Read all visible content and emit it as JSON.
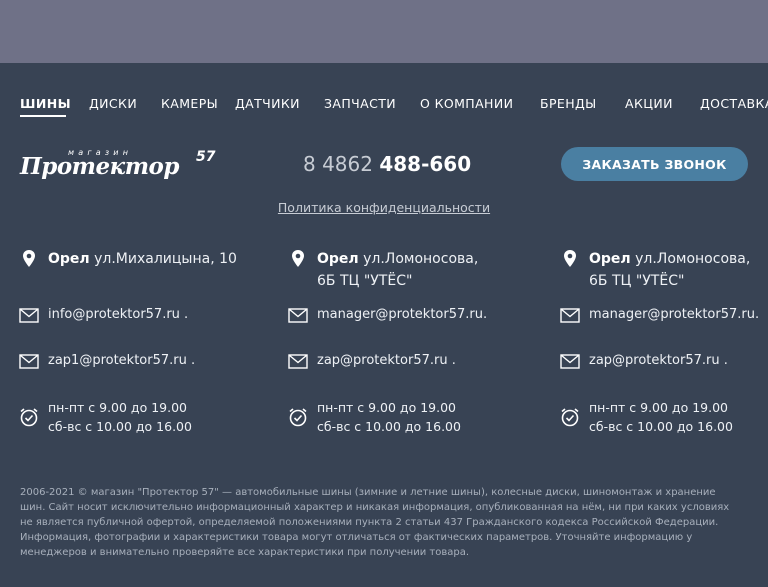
{
  "nav": {
    "items": [
      {
        "label": "ШИНЫ",
        "active": true
      },
      {
        "label": "ДИСКИ"
      },
      {
        "label": "КАМЕРЫ"
      },
      {
        "label": "ДАТЧИКИ"
      },
      {
        "label": "ЗАПЧАСТИ"
      },
      {
        "label": "О КОМПАНИИ"
      },
      {
        "label": "БРЕНДЫ"
      },
      {
        "label": "АКЦИИ"
      },
      {
        "label": "ДОСТАВКА"
      }
    ]
  },
  "logo": {
    "small": "магазин",
    "main": "Протектор",
    "number": "57"
  },
  "phone": {
    "prefix": "8 4862",
    "number": "488-660"
  },
  "call_button": "ЗАКАЗАТЬ ЗВОНОК",
  "policy_link": "Политика конфиденциальности",
  "locations": [
    {
      "city": "Орел",
      "address": "ул.Михалицына, 10",
      "email1": "info@protektor57.ru .",
      "email2": "zap1@protektor57.ru .",
      "hours1": "пн-пт с 9.00 до 19.00",
      "hours2": "сб-вс с 10.00 до 16.00"
    },
    {
      "city": "Орел",
      "address": "ул.Ломоносова,",
      "address2": "6Б ТЦ \"УТЁС\"",
      "email1": "manager@protektor57.ru.",
      "email2": "zap@protektor57.ru .",
      "hours1": "пн-пт с 9.00 до 19.00",
      "hours2": "сб-вс с 10.00 до 16.00"
    },
    {
      "city": "Орел",
      "address": "ул.Ломоносова,",
      "address2": "6Б ТЦ \"УТЁС\"",
      "email1": "manager@protektor57.ru.",
      "email2": "zap@protektor57.ru .",
      "hours1": "пн-пт с 9.00 до 19.00",
      "hours2": "сб-вс с 10.00 до 16.00"
    }
  ],
  "disclaimer": "2006-2021 © магазин \"Протектор 57\" — автомобильные шины (зимние и летние шины), колесные диски, шиномонтаж и хранение шин. Сайт носит исключительно информационный характер и никакая информация, опубликованная на нём, ни при каких условиях не является публичной офертой, определяемой положениями пункта 2 статьи 437 Гражданского кодекса Российской Федерации. Информация, фотографии и характеристики товара могут отличаться от фактических параметров. Уточняйте информацию у менеджеров и внимательно проверяйте все характеристики при получении товара.",
  "colors": {
    "background": "#384354",
    "top_band": "#6f7187",
    "button": "#4a7fa2"
  },
  "icons": [
    "location-pin-icon",
    "envelope-icon",
    "alarm-clock-icon"
  ]
}
